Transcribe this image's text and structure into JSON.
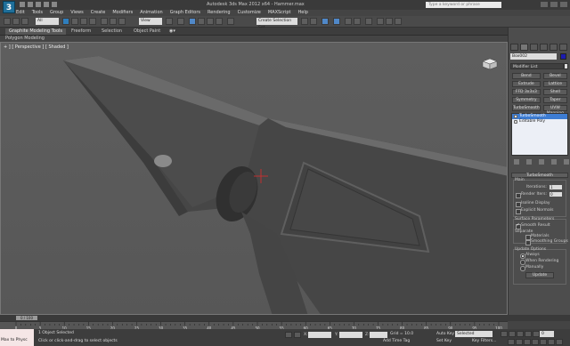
{
  "app": {
    "title": "Autodesk 3ds Max 2012 x64 - Hammer.max",
    "help_placeholder": "Type a keyword or phrase",
    "logo_letter": "3"
  },
  "menu": [
    "Edit",
    "Tools",
    "Group",
    "Views",
    "Create",
    "Modifiers",
    "Animation",
    "Graph Editors",
    "Rendering",
    "Customize",
    "MAXScript",
    "Help"
  ],
  "toolbar": {
    "selection_filter": "All",
    "ref_coord": "View",
    "named_selection": "Create Selection Set"
  },
  "ribbon": {
    "tabs": [
      "Graphite Modeling Tools",
      "Freeform",
      "Selection",
      "Object Paint"
    ],
    "active_tab": "Graphite Modeling Tools",
    "sub_label": "Polygon Modeling"
  },
  "viewport": {
    "label": "+ ] [ Perspective ] [ Shaded ]"
  },
  "command_panel": {
    "object_name": "Box002",
    "modifier_list": "Modifier List",
    "modifier_buttons": [
      "Bend",
      "Bevel",
      "Extrude",
      "Lattice",
      "FFD 3x3x3",
      "Shell",
      "Symmetry",
      "Taper",
      "TurboSmooth",
      "UVW Mapping Cle"
    ],
    "stack": [
      {
        "label": "TurboSmooth",
        "selected": true
      },
      {
        "label": "Editable Poly",
        "selected": false
      }
    ],
    "turbosmooth": {
      "rollout_title": "TurboSmooth",
      "main_label": "Main",
      "iterations_label": "Iterations:",
      "iterations_value": "1",
      "render_iters_label": "Render Iters:",
      "render_iters_value": "0",
      "isoline_label": "Isoline Display",
      "explicit_label": "Explicit Normals",
      "surface_label": "Surface Parameters",
      "smooth_result_label": "Smooth Result",
      "separate_label": "Separate",
      "materials_label": "Materials",
      "smoothing_groups_label": "Smoothing Groups",
      "update_label": "Update Options",
      "always_label": "Always",
      "when_rendering_label": "When Rendering",
      "manually_label": "Manually",
      "update_button": "Update"
    }
  },
  "timeline": {
    "slider_label": "0 / 100",
    "tick_labels": [
      "0",
      "5",
      "10",
      "15",
      "20",
      "25",
      "30",
      "35",
      "40",
      "45",
      "50",
      "55",
      "60",
      "65",
      "70",
      "75",
      "80",
      "85",
      "90",
      "95",
      "100"
    ]
  },
  "status": {
    "maxscript": "Max to Physc",
    "objects_selected": "1 Object Selected",
    "prompt": "Click or click-and-drag to select objects",
    "grid": "Grid = 10.0",
    "add_time_tag": "Add Time Tag",
    "auto_key": "Auto Key",
    "set_key": "Set Key",
    "selected_dd": "Selected",
    "key_filters": "Key Filters...",
    "frame": "0",
    "x_label": "X:",
    "y_label": "Y:",
    "z_label": "Z:"
  },
  "colors": {
    "object_color": "#1c1cb0",
    "selection_highlight": "#3d7cd2",
    "viewport_bg": "#5b5b5b",
    "model_face": "#4a4a4a"
  }
}
